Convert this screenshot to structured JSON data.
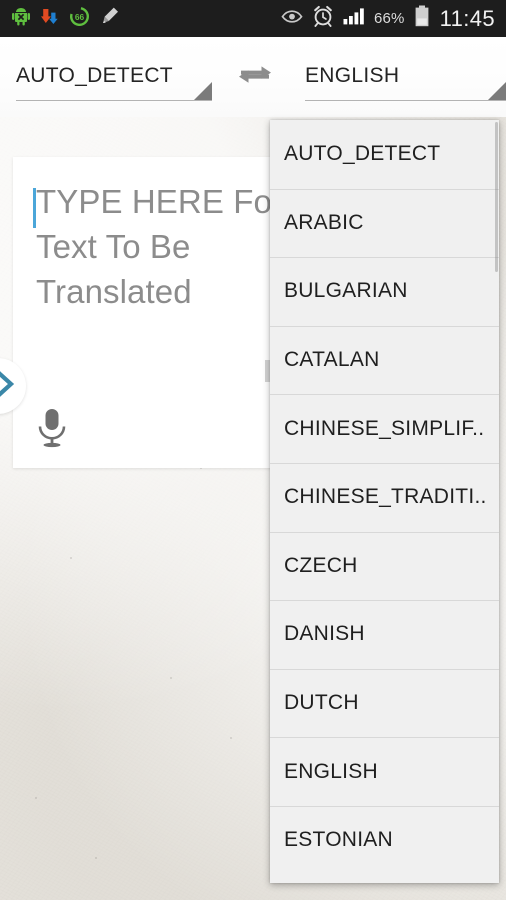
{
  "status_bar": {
    "time": "11:45",
    "battery_percent": "66%",
    "left_icons": [
      {
        "name": "android-app-icon",
        "glyph": "android-x"
      },
      {
        "name": "download-arrow-icon",
        "glyph": "download"
      },
      {
        "name": "battery-circle-66-icon",
        "glyph": "circle-66",
        "label": "66"
      },
      {
        "name": "pencil-marker-icon",
        "glyph": "pencil"
      }
    ],
    "right_icons": [
      {
        "name": "eye-icon",
        "glyph": "eye"
      },
      {
        "name": "alarm-clock-icon",
        "glyph": "alarm"
      },
      {
        "name": "signal-bars-icon",
        "glyph": "signal"
      },
      {
        "name": "battery-icon",
        "glyph": "battery"
      }
    ]
  },
  "language_bar": {
    "source_language": "AUTO_DETECT",
    "target_language": "ENGLISH",
    "swap_icon": "swap-horizontal-icon"
  },
  "input_card": {
    "placeholder": "TYPE HERE For Text To Be Translated",
    "value": "",
    "mic_icon": "microphone-icon",
    "caret_color": "#4ba6d9"
  },
  "side_fab": {
    "icon": "chevron-right-icon",
    "color": "#3b87a8"
  },
  "dropdown": {
    "open": true,
    "items": [
      {
        "label": "AUTO_DETECT"
      },
      {
        "label": "ARABIC"
      },
      {
        "label": "BULGARIAN"
      },
      {
        "label": "CATALAN"
      },
      {
        "label": "CHINESE_SIMPLIF.."
      },
      {
        "label": "CHINESE_TRADITI.."
      },
      {
        "label": "CZECH"
      },
      {
        "label": "DANISH"
      },
      {
        "label": "DUTCH"
      },
      {
        "label": "ENGLISH"
      },
      {
        "label": "ESTONIAN"
      }
    ]
  },
  "colors": {
    "status_bar_bg": "#1d1d1d",
    "page_bg": "#eeebe6",
    "card_bg": "#ffffff",
    "dropdown_bg": "#f0f0f0",
    "accent_blue": "#4ba6d9",
    "text_primary": "#1f1f1f",
    "text_placeholder": "#8c8c8c"
  }
}
